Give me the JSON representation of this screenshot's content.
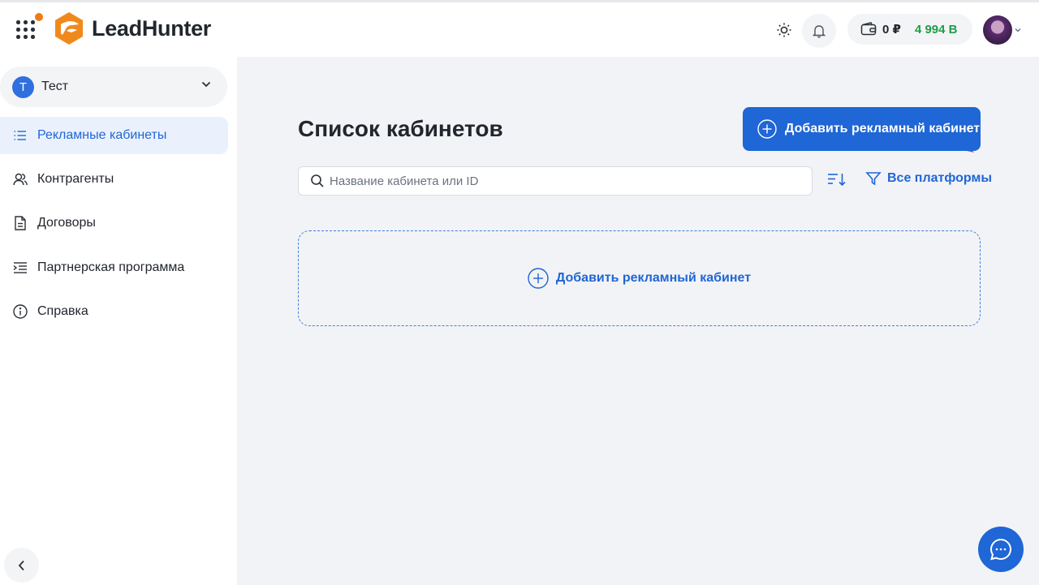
{
  "app": {
    "brand_name": "LeadHunter",
    "accent_color": "#1f66d6",
    "brand_color": "#f0891c"
  },
  "header": {
    "balance": "0 ₽",
    "bonus": "4 994 B",
    "icons": [
      "apps-grid-icon",
      "sun-icon",
      "bell-icon",
      "wallet-icon",
      "chevron-down-icon"
    ]
  },
  "sidebar": {
    "account": {
      "initial": "Т",
      "name": "Тест"
    },
    "items": [
      {
        "label": "Рекламные кабинеты",
        "icon": "list-icon",
        "active": true
      },
      {
        "label": "Контрагенты",
        "icon": "users-icon",
        "active": false
      },
      {
        "label": "Договоры",
        "icon": "document-icon",
        "active": false
      },
      {
        "label": "Партнерская программа",
        "icon": "indent-list-icon",
        "active": false
      },
      {
        "label": "Справка",
        "icon": "info-icon",
        "active": false
      }
    ]
  },
  "main": {
    "title": "Список кабинетов",
    "add_button_label": "Добавить рекламный кабинет",
    "search_placeholder": "Название кабинета или ID",
    "search_value": "",
    "platforms_label": "Все платформы",
    "empty_add_label": "Добавить рекламный кабинет"
  }
}
